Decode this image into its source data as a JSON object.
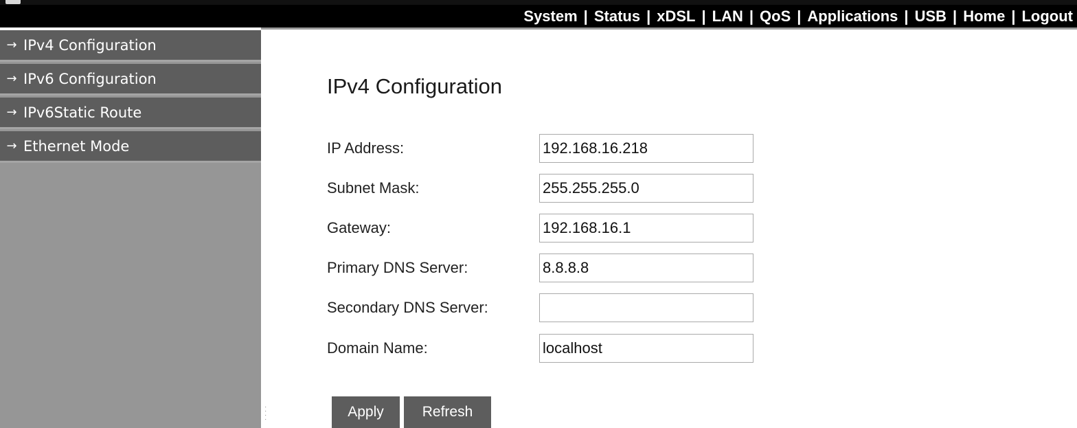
{
  "topnav": {
    "items": [
      "System",
      "Status",
      "xDSL",
      "LAN",
      "QoS",
      "Applications",
      "USB",
      "Home",
      "Logout"
    ],
    "separator": "|"
  },
  "sidebar": {
    "arrow": "→",
    "items": [
      {
        "label": "IPv4 Configuration"
      },
      {
        "label": "IPv6 Configuration"
      },
      {
        "label": "IPv6Static Route"
      },
      {
        "label": "Ethernet Mode"
      }
    ]
  },
  "main": {
    "title": "IPv4 Configuration",
    "fields": [
      {
        "label": "IP Address:",
        "value": "192.168.16.218"
      },
      {
        "label": "Subnet Mask:",
        "value": "255.255.255.0"
      },
      {
        "label": "Gateway:",
        "value": "192.168.16.1"
      },
      {
        "label": "Primary DNS Server:",
        "value": "8.8.8.8"
      },
      {
        "label": "Secondary DNS Server:",
        "value": ""
      },
      {
        "label": "Domain Name:",
        "value": "localhost"
      }
    ],
    "buttons": {
      "apply": "Apply",
      "refresh": "Refresh"
    }
  },
  "colors": {
    "topbar": "#000000",
    "sidebar_item": "#5d5d5d",
    "sidebar_bg": "#969696",
    "button": "#5d5d5d"
  }
}
